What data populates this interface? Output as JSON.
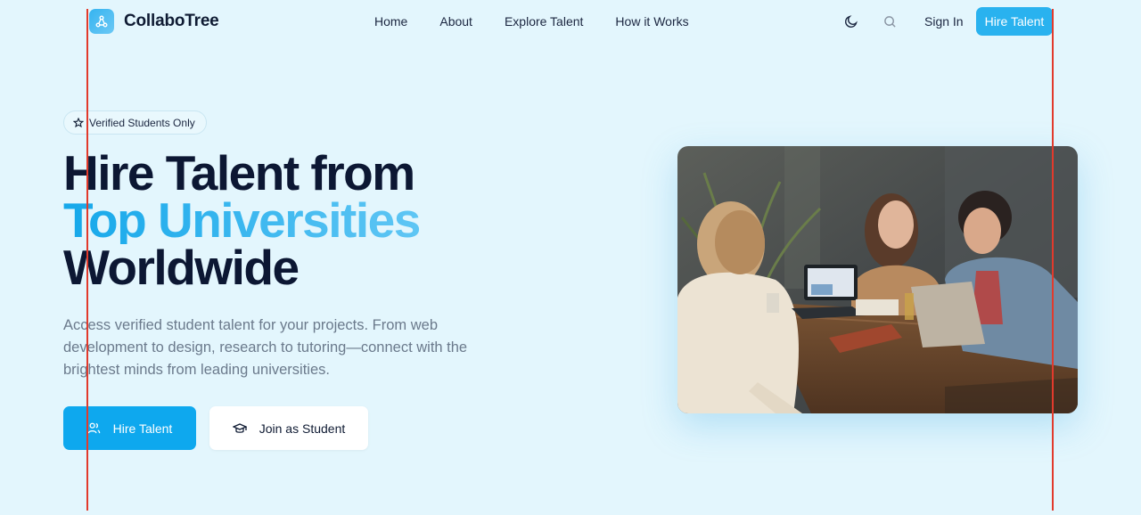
{
  "brand": {
    "name": "CollaboTree",
    "logo_icon": "network-nodes-icon"
  },
  "nav": {
    "items": [
      "Home",
      "About",
      "Explore Talent",
      "How it Works"
    ]
  },
  "header": {
    "theme_icon": "moon-icon",
    "search_icon": "search-icon",
    "sign_in": "Sign In",
    "hire_button": "Hire Talent"
  },
  "hero": {
    "badge": "Verified Students Only",
    "badge_icon": "star-icon",
    "headline_line1": "Hire Talent from",
    "headline_line2": "Top Universities",
    "headline_line3": "Worldwide",
    "description": "Access verified student talent for your projects. From web development to design, research to tutoring—connect with the brightest minds from leading universities.",
    "primary_button": "Hire Talent",
    "primary_icon": "users-icon",
    "secondary_button": "Join as Student",
    "secondary_icon": "graduation-cap-icon"
  },
  "colors": {
    "accent": "#0ea8ee",
    "background": "#e3f6fd",
    "heading": "#0c1733",
    "guide_line": "#e23a2c"
  }
}
